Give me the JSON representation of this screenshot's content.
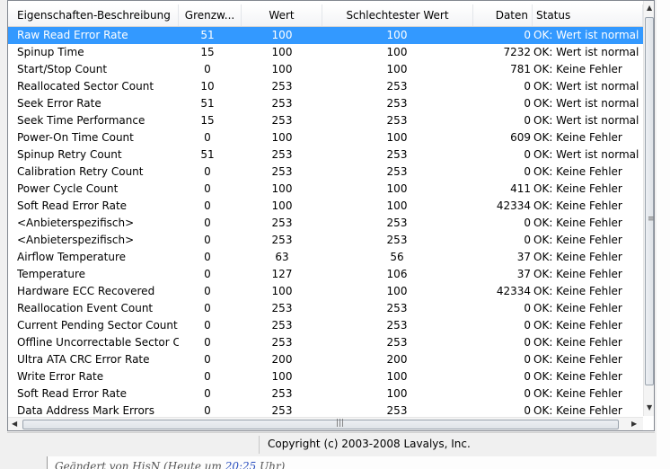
{
  "columns": [
    "Eigenschaften-Beschreibung",
    "Grenzw...",
    "Wert",
    "Schlechtester Wert",
    "Daten",
    "Status"
  ],
  "rows": [
    {
      "name": "Raw Read Error Rate",
      "threshold": "51",
      "value": "100",
      "worst": "100",
      "data": "0",
      "status": "OK: Wert ist normal",
      "selected": true
    },
    {
      "name": "Spinup Time",
      "threshold": "15",
      "value": "100",
      "worst": "100",
      "data": "7232",
      "status": "OK: Wert ist normal"
    },
    {
      "name": "Start/Stop Count",
      "threshold": "0",
      "value": "100",
      "worst": "100",
      "data": "781",
      "status": "OK: Keine Fehler"
    },
    {
      "name": "Reallocated Sector Count",
      "threshold": "10",
      "value": "253",
      "worst": "253",
      "data": "0",
      "status": "OK: Wert ist normal"
    },
    {
      "name": "Seek Error Rate",
      "threshold": "51",
      "value": "253",
      "worst": "253",
      "data": "0",
      "status": "OK: Wert ist normal"
    },
    {
      "name": "Seek Time Performance",
      "threshold": "15",
      "value": "253",
      "worst": "253",
      "data": "0",
      "status": "OK: Wert ist normal"
    },
    {
      "name": "Power-On Time Count",
      "threshold": "0",
      "value": "100",
      "worst": "100",
      "data": "609",
      "status": "OK: Keine Fehler"
    },
    {
      "name": "Spinup Retry Count",
      "threshold": "51",
      "value": "253",
      "worst": "253",
      "data": "0",
      "status": "OK: Wert ist normal"
    },
    {
      "name": "Calibration Retry Count",
      "threshold": "0",
      "value": "253",
      "worst": "253",
      "data": "0",
      "status": "OK: Keine Fehler"
    },
    {
      "name": "Power Cycle Count",
      "threshold": "0",
      "value": "100",
      "worst": "100",
      "data": "411",
      "status": "OK: Keine Fehler"
    },
    {
      "name": "Soft Read Error Rate",
      "threshold": "0",
      "value": "100",
      "worst": "100",
      "data": "42334",
      "status": "OK: Keine Fehler"
    },
    {
      "name": "<Anbieterspezifisch>",
      "threshold": "0",
      "value": "253",
      "worst": "253",
      "data": "0",
      "status": "OK: Keine Fehler"
    },
    {
      "name": "<Anbieterspezifisch>",
      "threshold": "0",
      "value": "253",
      "worst": "253",
      "data": "0",
      "status": "OK: Keine Fehler"
    },
    {
      "name": "Airflow Temperature",
      "threshold": "0",
      "value": "63",
      "worst": "56",
      "data": "37",
      "status": "OK: Keine Fehler"
    },
    {
      "name": "Temperature",
      "threshold": "0",
      "value": "127",
      "worst": "106",
      "data": "37",
      "status": "OK: Keine Fehler"
    },
    {
      "name": "Hardware ECC Recovered",
      "threshold": "0",
      "value": "100",
      "worst": "100",
      "data": "42334",
      "status": "OK: Keine Fehler"
    },
    {
      "name": "Reallocation Event Count",
      "threshold": "0",
      "value": "253",
      "worst": "253",
      "data": "0",
      "status": "OK: Keine Fehler"
    },
    {
      "name": "Current Pending Sector Count",
      "threshold": "0",
      "value": "253",
      "worst": "253",
      "data": "0",
      "status": "OK: Keine Fehler"
    },
    {
      "name": "Offline Uncorrectable Sector C...",
      "threshold": "0",
      "value": "253",
      "worst": "253",
      "data": "0",
      "status": "OK: Keine Fehler"
    },
    {
      "name": "Ultra ATA CRC Error Rate",
      "threshold": "0",
      "value": "200",
      "worst": "200",
      "data": "0",
      "status": "OK: Keine Fehler"
    },
    {
      "name": "Write Error Rate",
      "threshold": "0",
      "value": "100",
      "worst": "100",
      "data": "0",
      "status": "OK: Keine Fehler"
    },
    {
      "name": "Soft Read Error Rate",
      "threshold": "0",
      "value": "253",
      "worst": "100",
      "data": "0",
      "status": "OK: Keine Fehler"
    },
    {
      "name": "Data Address Mark Errors",
      "threshold": "0",
      "value": "253",
      "worst": "253",
      "data": "0",
      "status": "OK: Keine Fehler"
    }
  ],
  "status_bar": {
    "copyright": "Copyright (c) 2003-2008 Lavalys, Inc."
  },
  "background_text": {
    "prefix": "Geändert von HisN (Heute um ",
    "time": "20:25",
    "suffix": " Uhr)"
  },
  "colors": {
    "selection": "#3399ff",
    "selection_text": "#ffffff"
  },
  "icons": {
    "scroll_up": "arrow-up-icon",
    "scroll_down": "arrow-down-icon",
    "scroll_left": "arrow-left-icon",
    "scroll_right": "arrow-right-icon"
  }
}
